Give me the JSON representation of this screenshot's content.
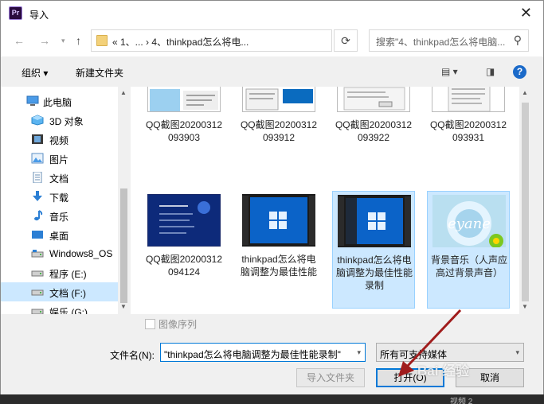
{
  "window": {
    "app_icon": "premiere-pro-icon",
    "app_icon_text": "Pr",
    "title": "导入",
    "close_icon": "close-icon"
  },
  "navigation": {
    "back_icon": "arrow-left-icon",
    "forward_icon": "arrow-right-icon",
    "history_icon": "chevron-down-icon",
    "up_icon": "arrow-up-icon",
    "address_path": "«  1、...  ›  4、thinkpad怎么将电...",
    "refresh_icon": "refresh-icon",
    "search_placeholder": "搜索\"4、thinkpad怎么将电脑..."
  },
  "toolbar": {
    "organize": "组织 ▾",
    "new_folder": "新建文件夹"
  },
  "sidebar": {
    "items": [
      {
        "label": "此电脑",
        "icon": "computer-icon"
      },
      {
        "label": "3D 对象",
        "icon": "3d-objects-icon"
      },
      {
        "label": "视频",
        "icon": "video-icon"
      },
      {
        "label": "图片",
        "icon": "pictures-icon"
      },
      {
        "label": "文档",
        "icon": "documents-icon"
      },
      {
        "label": "下载",
        "icon": "download-icon"
      },
      {
        "label": "音乐",
        "icon": "music-icon"
      },
      {
        "label": "桌面",
        "icon": "desktop-icon"
      },
      {
        "label": "Windows8_OS",
        "icon": "drive-icon"
      },
      {
        "label": "程序 (E:)",
        "icon": "drive-icon"
      },
      {
        "label": "文档 (F:)",
        "icon": "drive-icon"
      },
      {
        "label": "娱乐 (G:)",
        "icon": "drive-icon"
      }
    ]
  },
  "files": [
    {
      "name": "QQ截图20200312093903"
    },
    {
      "name": "QQ截图20200312093912"
    },
    {
      "name": "QQ截图20200312093922"
    },
    {
      "name": "QQ截图20200312093931"
    },
    {
      "name": "QQ截图20200312094124"
    },
    {
      "name": "thinkpad怎么将电脑调整为最佳性能"
    },
    {
      "name": "thinkpad怎么将电脑调整为最佳性能录制"
    },
    {
      "name": "背景音乐（人声应高过背景声音）"
    }
  ],
  "bottom": {
    "image_sequence_label": "图像序列",
    "filename_label": "文件名(N):",
    "filename_value": "\"thinkpad怎么将电脑调整为最佳性能录制\"",
    "filetype_value": "所有可支持媒体",
    "import_folder_button": "导入文件夹",
    "open_button": "打开(O)",
    "cancel_button": "取消"
  },
  "watermark": "Bai 经验",
  "taskbar_label": "视频 2",
  "colors": {
    "accent": "#0078d7",
    "selection": "#cce8ff",
    "arrow": "#a01c1c"
  }
}
